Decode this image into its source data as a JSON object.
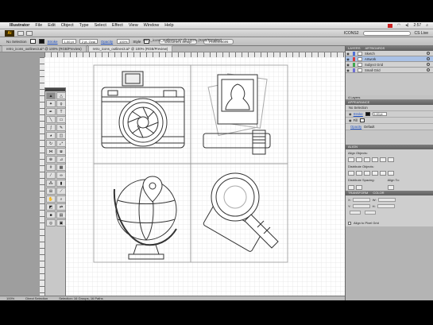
{
  "menubar": {
    "app_name": "Illustrator",
    "items": [
      "File",
      "Edit",
      "Object",
      "Type",
      "Select",
      "Effect",
      "View",
      "Window",
      "Help"
    ],
    "time": "2:57"
  },
  "appbar": {
    "logo": "Ai",
    "workspace": "ICONS2",
    "cs_live": "CS Live"
  },
  "control": {
    "selection": "No Selection",
    "stroke_link": "Stroke",
    "stroke_weight": "1.00 pt",
    "brush_def": "2 pt. Oval",
    "opacity_link": "Opacity",
    "opacity_value": "100%",
    "style_label": "Style",
    "doc_setup": "Document Setup",
    "preferences": "Preferences"
  },
  "document": {
    "title": "retro_icons_outlines3.ai* @ 100% (RGB/Preview)",
    "tabs": [
      "retro_icons_outlines3.ai* @ 100% (RGB/Preview)",
      "retro_icons_outlines3.ai* @ 100% (RGB/Preview)"
    ]
  },
  "layers_panel": {
    "tabs": [
      "LAYERS",
      "ARTBOARDS"
    ],
    "layers": [
      {
        "name": "Sketch",
        "color": "#4f6fd6"
      },
      {
        "name": "Artwork",
        "color": "#d63f3f"
      },
      {
        "name": "Subject Grid",
        "color": "#3fa84f"
      },
      {
        "name": "Small Grid",
        "color": "#6f6fd6"
      }
    ],
    "footer": "4 Layers"
  },
  "appearance_panel": {
    "tabs": [
      "APPEARANCE"
    ],
    "selection": "No Selection",
    "stroke_link": "Stroke",
    "stroke_value": "1.00 pt",
    "fill_label": "Fill",
    "opacity_link": "Opacity",
    "opacity_value": "Default"
  },
  "align_panel": {
    "tabs": [
      "ALIGN"
    ],
    "align_objects": "Align Objects:",
    "distribute_objects": "Distribute Objects:",
    "distribute_spacing": "Distribute Spacing:",
    "align_to": "Align To:"
  },
  "transform_panel": {
    "tabs": [
      "TRANSFORM",
      "COLOR"
    ],
    "x_label": "X:",
    "y_label": "Y:",
    "w_label": "W:",
    "h_label": "H:",
    "align_pixel": "Align to Pixel Grid"
  },
  "statusbar": {
    "zoom": "100%",
    "tool": "Direct Selection",
    "message": "Selection: 16 Groups, 16 Paths"
  }
}
